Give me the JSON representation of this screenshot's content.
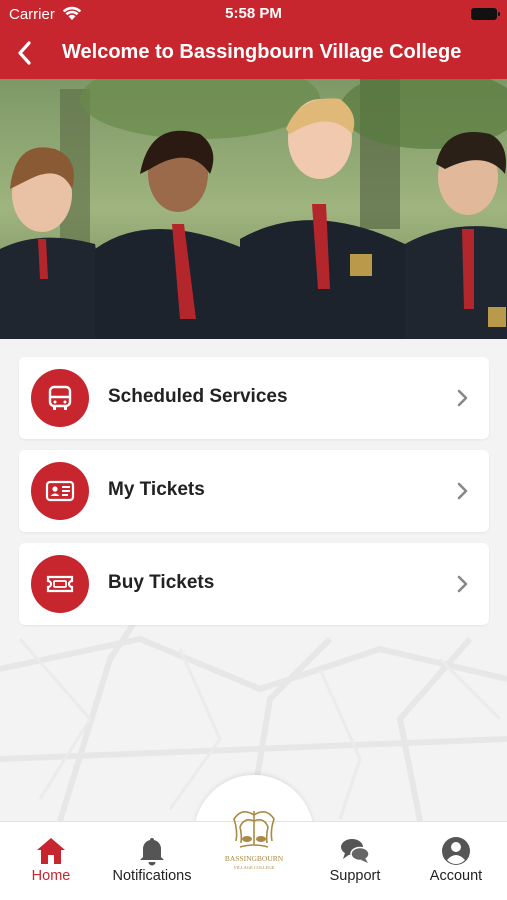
{
  "status_bar": {
    "carrier": "Carrier",
    "time": "5:58 PM"
  },
  "nav": {
    "title": "Welcome to Bassingbourn Village College"
  },
  "menu": [
    {
      "label": "Scheduled Services",
      "icon": "bus-icon"
    },
    {
      "label": "My Tickets",
      "icon": "id-card-icon"
    },
    {
      "label": "Buy Tickets",
      "icon": "ticket-icon"
    }
  ],
  "tabs": [
    {
      "label": "Home",
      "icon": "home-icon",
      "active": true
    },
    {
      "label": "Notifications",
      "icon": "bell-icon"
    },
    {
      "label": "Support",
      "icon": "chat-icon"
    },
    {
      "label": "Account",
      "icon": "account-icon"
    }
  ],
  "logo": {
    "text": "BASSINGBOURN",
    "subtext": "VILLAGE COLLEGE"
  },
  "colors": {
    "brand": "#c8262f",
    "tab_inactive": "#555555"
  }
}
